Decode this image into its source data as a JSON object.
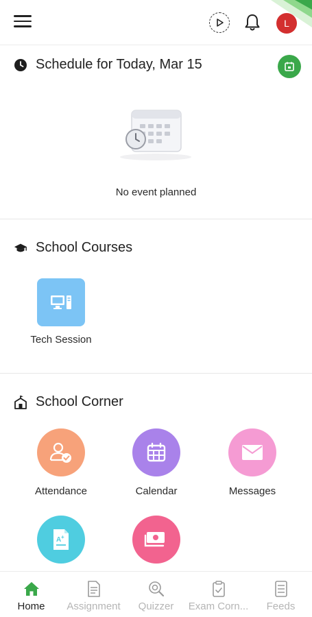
{
  "header": {
    "avatar_initial": "L",
    "icons": [
      "menu-icon",
      "play-icon",
      "bell-icon"
    ]
  },
  "schedule": {
    "title": "Schedule for Today, Mar 15",
    "empty_text": "No event planned",
    "icon": "clock-icon",
    "action_icon": "calendar-icon"
  },
  "courses": {
    "title": "School Courses",
    "icon": "graduation-cap-icon",
    "items": [
      {
        "label": "Tech Session",
        "icon": "computer-icon",
        "color": "#7cc4f5"
      }
    ]
  },
  "corner": {
    "title": "School Corner",
    "icon": "school-building-icon",
    "items": [
      {
        "label": "Attendance",
        "icon": "attendance-icon",
        "color": "#f7a27a"
      },
      {
        "label": "Calendar",
        "icon": "calendar-grid-icon",
        "color": "#a982ea"
      },
      {
        "label": "Messages",
        "icon": "envelope-icon",
        "color": "#f59bd3"
      },
      {
        "label": "",
        "icon": "report-card-icon",
        "color": "#4fcde0"
      },
      {
        "label": "",
        "icon": "money-icon",
        "color": "#f2638f"
      }
    ]
  },
  "bottom_nav": {
    "items": [
      {
        "label": "Home",
        "icon": "home-icon",
        "active": true
      },
      {
        "label": "Assignment",
        "icon": "document-icon",
        "active": false
      },
      {
        "label": "Quizzer",
        "icon": "quizzer-icon",
        "active": false
      },
      {
        "label": "Exam Corn...",
        "icon": "clipboard-check-icon",
        "active": false
      },
      {
        "label": "Feeds",
        "icon": "feeds-icon",
        "active": false
      }
    ]
  },
  "colors": {
    "accent_green": "#3aa84a",
    "avatar_red": "#d32f2f",
    "inactive_text": "#b5b5b5"
  }
}
